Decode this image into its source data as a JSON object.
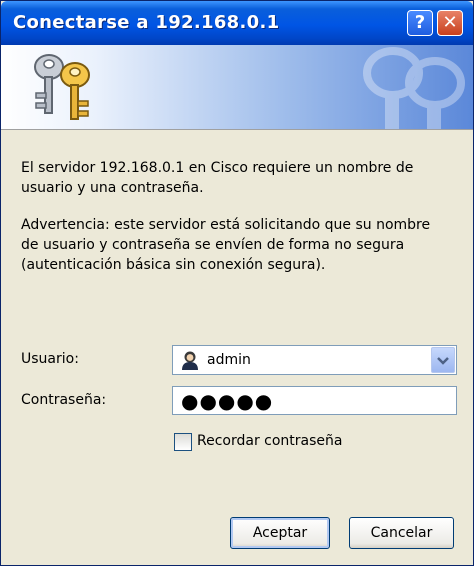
{
  "window": {
    "title": "Conectarse a 192.168.0.1",
    "help_label": "?",
    "close_label": "✕"
  },
  "message": {
    "line1": "El servidor 192.168.0.1 en Cisco requiere un nombre de",
    "line2": "usuario y una contraseña.",
    "warning1": "Advertencia: este servidor está solicitando que su nombre",
    "warning2": "de usuario y contraseña se envíen de forma no segura",
    "warning3": "(autenticación básica sin conexión segura)."
  },
  "form": {
    "user_label": "Usuario:",
    "user_value": "admin",
    "password_label": "Contraseña:",
    "password_value": "●●●●●",
    "remember_label": "Recordar contraseña",
    "remember_checked": false
  },
  "buttons": {
    "ok": "Aceptar",
    "cancel": "Cancelar"
  },
  "colors": {
    "titlebar": "#0055E5",
    "dialog_bg": "#ECE9D8"
  },
  "icons": [
    "keys-icon",
    "user-icon",
    "chevron-down-icon",
    "help-icon",
    "close-icon"
  ]
}
